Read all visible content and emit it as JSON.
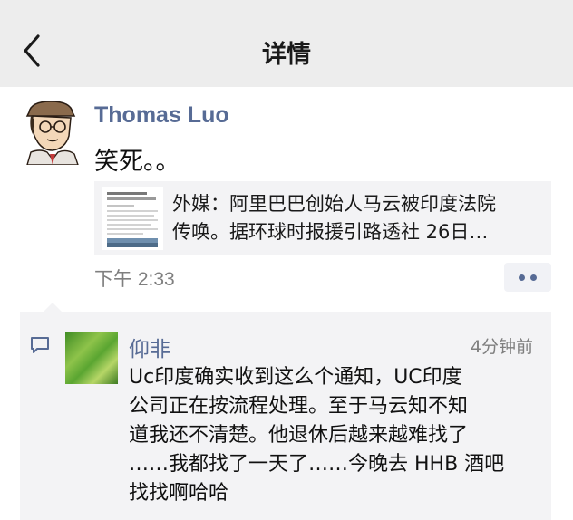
{
  "nav": {
    "title": "详情"
  },
  "post": {
    "author": "Thomas Luo",
    "text": "笑死。。",
    "shared_link": {
      "title_lines": [
        "外媒：阿里巴巴创始人马云被印度法院",
        "传唤。据环球时报援引路透社 26日…"
      ]
    },
    "time": "下午 2:33"
  },
  "comment": {
    "author": "仰非",
    "time": "4分钟前",
    "text_lines": [
      "Uc印度确实收到这么个通知，UC印度",
      "公司正在按流程处理。至于马云知不知",
      "道我还不清楚。他退休后越来越难找了",
      "……我都找了一天了……今晚去 HHB 酒吧",
      "找找啊哈哈"
    ]
  },
  "colors": {
    "nav_bg": "#ededed",
    "link_blue": "#576b95",
    "card_bg": "#f3f3f5",
    "muted": "#7f7f7f"
  }
}
